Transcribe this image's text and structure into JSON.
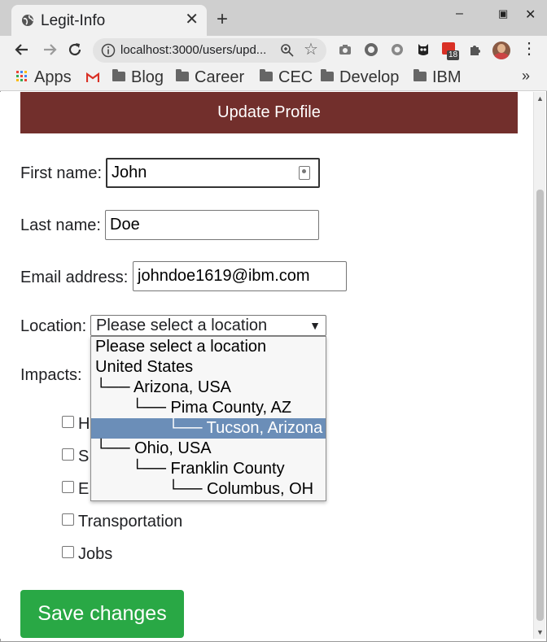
{
  "browser": {
    "tab_title": "Legit-Info",
    "url": "localhost:3000/users/upd...",
    "extension_badge": "18"
  },
  "bookmarks": [
    {
      "label": "Apps",
      "icon": "apps-grid-icon"
    },
    {
      "label": "",
      "icon": "gmail-icon"
    },
    {
      "label": "Blog",
      "icon": "folder-icon"
    },
    {
      "label": "Career",
      "icon": "folder-icon"
    },
    {
      "label": "CEC",
      "icon": "folder-icon"
    },
    {
      "label": "Develop",
      "icon": "folder-icon"
    },
    {
      "label": "IBM",
      "icon": "folder-icon"
    }
  ],
  "page": {
    "header": "Update Profile",
    "first_name_label": "First name:",
    "first_name_value": "John",
    "last_name_label": "Last name:",
    "last_name_value": "Doe",
    "email_label": "Email address:",
    "email_value": "johndoe1619@ibm.com",
    "location_label": "Location:",
    "location_selected": "Please select a location",
    "location_options": [
      "Please select a location",
      "United States",
      "└── Arizona, USA",
      "        └── Pima County, AZ",
      "                └── Tucson, Arizona",
      "└── Ohio, USA",
      "        └── Franklin County",
      "                └── Columbus, OH"
    ],
    "highlighted_option_index": 4,
    "impacts_label": "Impacts:",
    "impacts": [
      {
        "label": "H",
        "checked": false
      },
      {
        "label": "S",
        "checked": false
      },
      {
        "label": "E",
        "checked": false
      },
      {
        "label": "Transportation",
        "checked": false
      },
      {
        "label": "Jobs",
        "checked": false
      }
    ],
    "save_button": "Save changes"
  },
  "colors": {
    "header_bg": "#722f2c",
    "save_bg": "#29a845",
    "option_highlight": "#6b8eb8"
  }
}
